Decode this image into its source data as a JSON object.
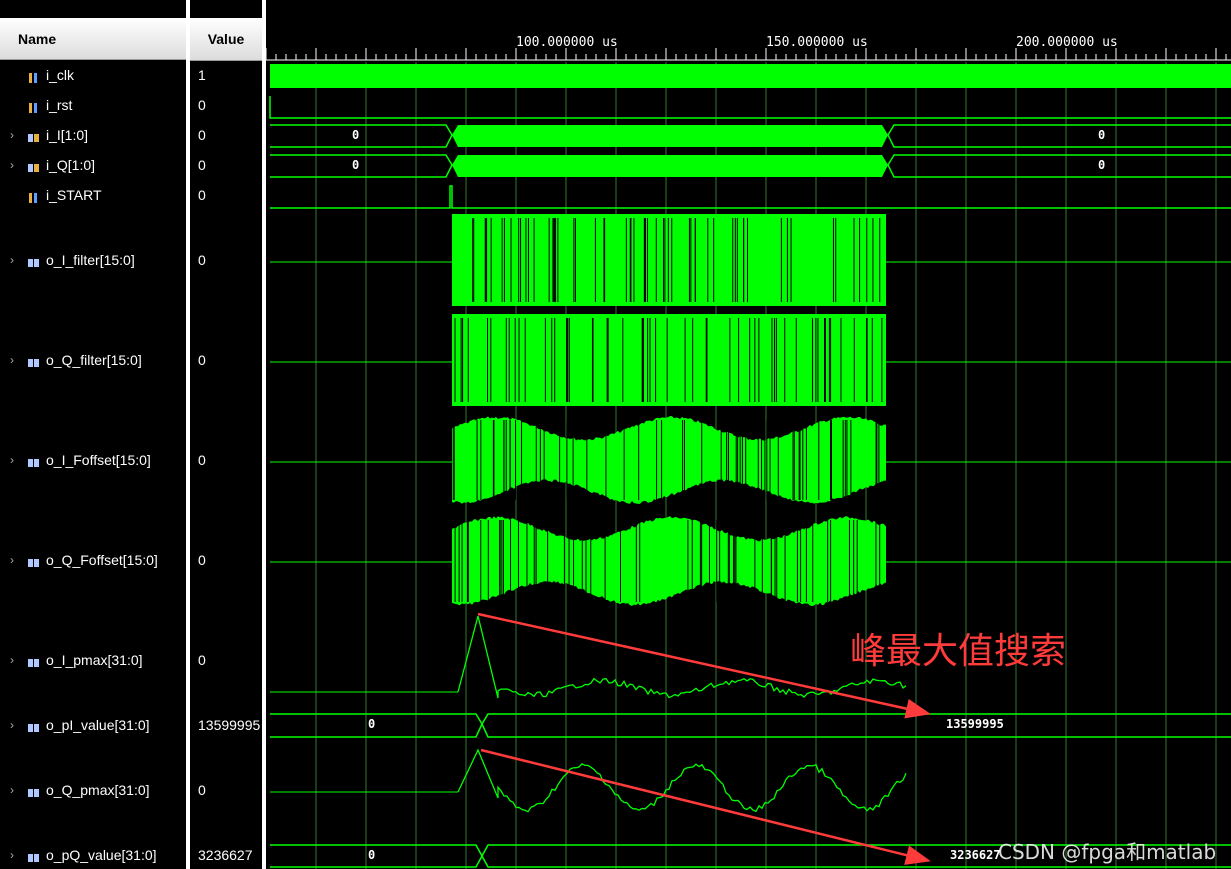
{
  "headers": {
    "name": "Name",
    "value": "Value"
  },
  "time_axis": {
    "labels": [
      "100.000000 us",
      "150.000000 us",
      "200.000000 us"
    ]
  },
  "signals": [
    {
      "name": "i_clk",
      "value": "1",
      "icon": "single-bit-signal-icon"
    },
    {
      "name": "i_rst",
      "value": "0",
      "icon": "single-bit-signal-icon"
    },
    {
      "name": "i_I[1:0]",
      "value": "0",
      "icon": "bus-signal-icon"
    },
    {
      "name": "i_Q[1:0]",
      "value": "0",
      "icon": "bus-signal-icon"
    },
    {
      "name": "i_START",
      "value": "0",
      "icon": "single-bit-signal-icon"
    },
    {
      "name": "o_I_filter[15:0]",
      "value": "0",
      "icon": "bus-signal-icon"
    },
    {
      "name": "o_Q_filter[15:0]",
      "value": "0",
      "icon": "bus-signal-icon"
    },
    {
      "name": "o_I_Foffset[15:0]",
      "value": "0",
      "icon": "bus-signal-icon"
    },
    {
      "name": "o_Q_Foffset[15:0]",
      "value": "0",
      "icon": "bus-signal-icon"
    },
    {
      "name": "o_I_pmax[31:0]",
      "value": "0",
      "icon": "bus-signal-icon"
    },
    {
      "name": "o_pI_value[31:0]",
      "value": "13599995",
      "icon": "bus-signal-icon"
    },
    {
      "name": "o_Q_pmax[31:0]",
      "value": "0",
      "icon": "bus-signal-icon"
    },
    {
      "name": "o_pQ_value[31:0]",
      "value": "3236627",
      "icon": "bus-signal-icon"
    }
  ],
  "bus_values": {
    "i_I_before": "0",
    "i_I_after": "0",
    "i_Q_before": "0",
    "i_Q_after": "0",
    "pI_before": "0",
    "pI_after": "13599995",
    "pQ_before": "0",
    "pQ_after": "3236627"
  },
  "annotation": "峰最大值搜索",
  "watermark": "CSDN @fpga和matlab",
  "colors": {
    "wave": "#00ff00",
    "grid": "#00b000",
    "annotation": "#ff3b3b",
    "background": "#000000"
  }
}
